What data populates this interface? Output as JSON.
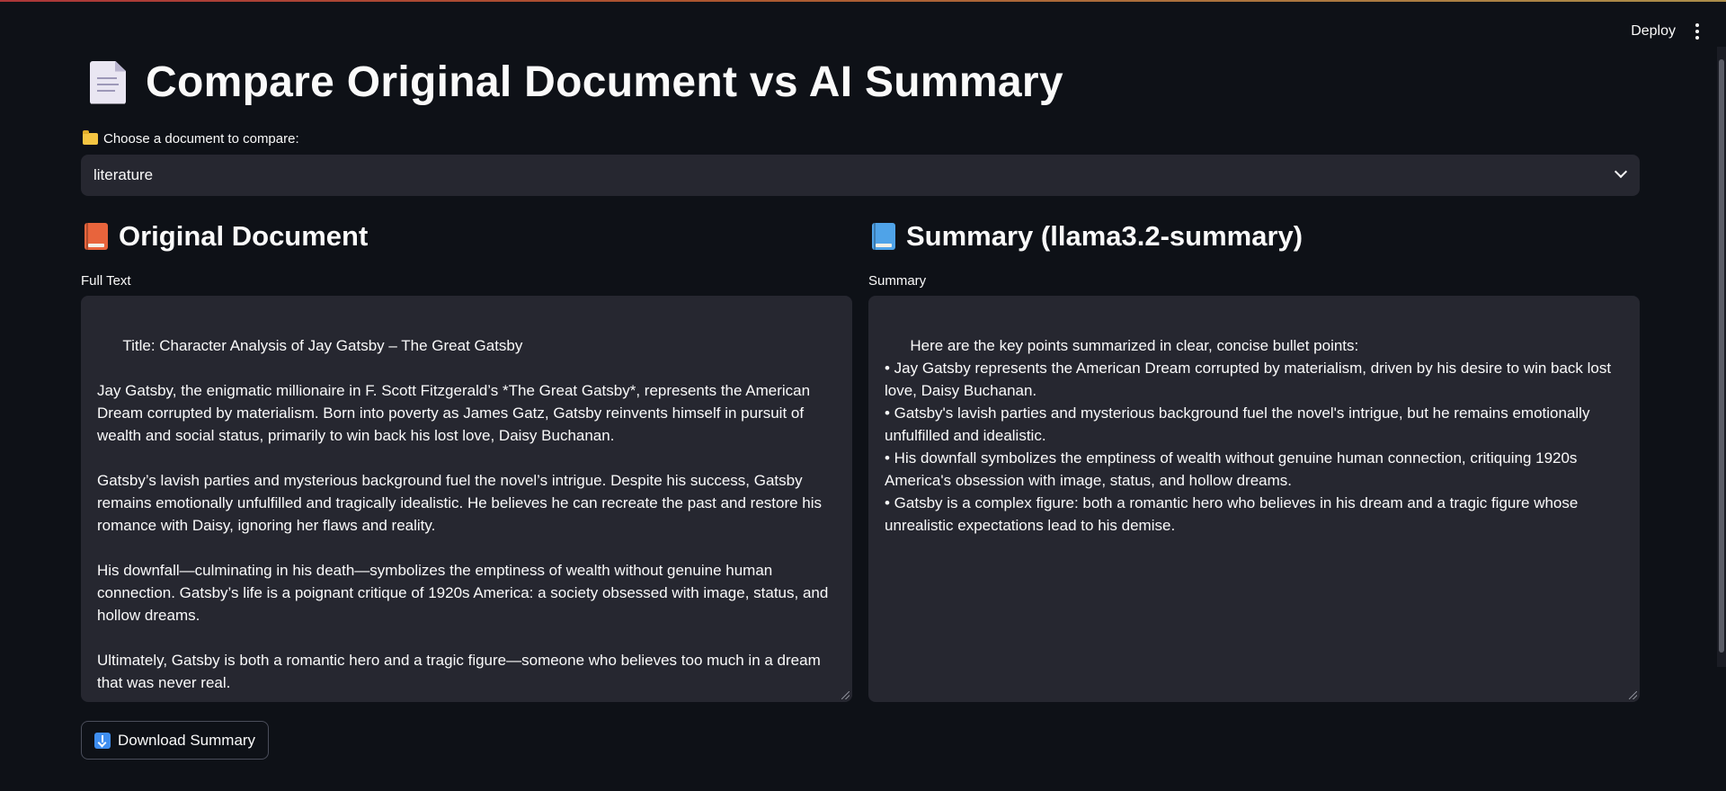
{
  "header": {
    "deploy_label": "Deploy"
  },
  "page": {
    "title": "Compare Original Document vs AI Summary"
  },
  "selector": {
    "label": "Choose a document to compare:",
    "selected": "literature"
  },
  "original": {
    "heading": "Original Document",
    "field_label": "Full Text",
    "text": "Title: Character Analysis of Jay Gatsby – The Great Gatsby\n\nJay Gatsby, the enigmatic millionaire in F. Scott Fitzgerald’s *The Great Gatsby*, represents the American Dream corrupted by materialism. Born into poverty as James Gatz, Gatsby reinvents himself in pursuit of wealth and social status, primarily to win back his lost love, Daisy Buchanan.\n\nGatsby’s lavish parties and mysterious background fuel the novel’s intrigue. Despite his success, Gatsby remains emotionally unfulfilled and tragically idealistic. He believes he can recreate the past and restore his romance with Daisy, ignoring her flaws and reality.\n\nHis downfall—culminating in his death—symbolizes the emptiness of wealth without genuine human connection. Gatsby’s life is a poignant critique of 1920s America: a society obsessed with image, status, and hollow dreams.\n\nUltimately, Gatsby is both a romantic hero and a tragic figure—someone who believes too much in a dream that was never real."
  },
  "summary": {
    "heading": "Summary (llama3.2-summary)",
    "field_label": "Summary",
    "text": "Here are the key points summarized in clear, concise bullet points:\n• Jay Gatsby represents the American Dream corrupted by materialism, driven by his desire to win back lost love, Daisy Buchanan.\n• Gatsby's lavish parties and mysterious background fuel the novel's intrigue, but he remains emotionally unfulfilled and idealistic.\n• His downfall symbolizes the emptiness of wealth without genuine human connection, critiquing 1920s America's obsession with image, status, and hollow dreams.\n• Gatsby is a complex figure: both a romantic hero who believes in his dream and a tragic figure whose unrealistic expectations lead to his demise."
  },
  "download": {
    "label": "Download Summary"
  },
  "icons": {
    "title": "document-icon",
    "selector": "folder-icon",
    "original": "orange-book-icon",
    "summary": "blue-book-icon",
    "download": "download-arrow-icon"
  },
  "colors": {
    "background": "#0e1117",
    "surface": "#262730",
    "text": "#fafafa",
    "accent": "#ff4b4b"
  }
}
